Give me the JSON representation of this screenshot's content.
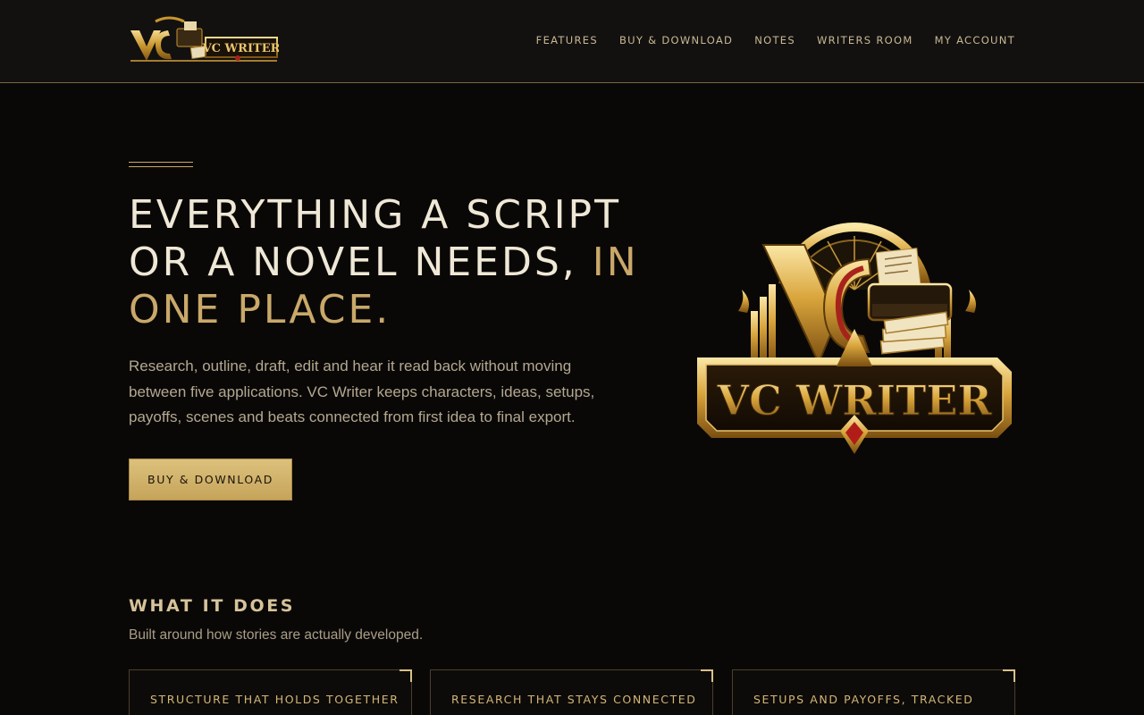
{
  "header": {
    "logo_text": "VC WRITER",
    "nav": [
      "FEATURES",
      "BUY & DOWNLOAD",
      "NOTES",
      "WRITERS ROOM",
      "MY ACCOUNT"
    ]
  },
  "hero": {
    "title_main": "EVERYTHING A SCRIPT OR A NOVEL NEEDS, ",
    "title_accent": "IN ONE PLACE.",
    "description": "Research, outline, draft, edit and hear it read back without moving between five applications. VC Writer keeps characters, ideas, setups, payoffs, scenes and beats connected from first idea to final export.",
    "cta_label": "BUY & DOWNLOAD",
    "logo_text": "VC WRITER"
  },
  "section": {
    "title": "WHAT IT DOES",
    "subtitle": "Built around how stories are actually developed.",
    "cards": [
      {
        "title": "STRUCTURE THAT HOLDS TOGETHER"
      },
      {
        "title": "RESEARCH THAT STAYS CONNECTED"
      },
      {
        "title": "SETUPS AND PAYOFFS, TRACKED"
      }
    ]
  },
  "colors": {
    "background": "#0a0807",
    "header_bg": "#121110",
    "gold_accent": "#c9a869",
    "button_gold": "#d4b56c",
    "text_light": "#efe8d6"
  }
}
